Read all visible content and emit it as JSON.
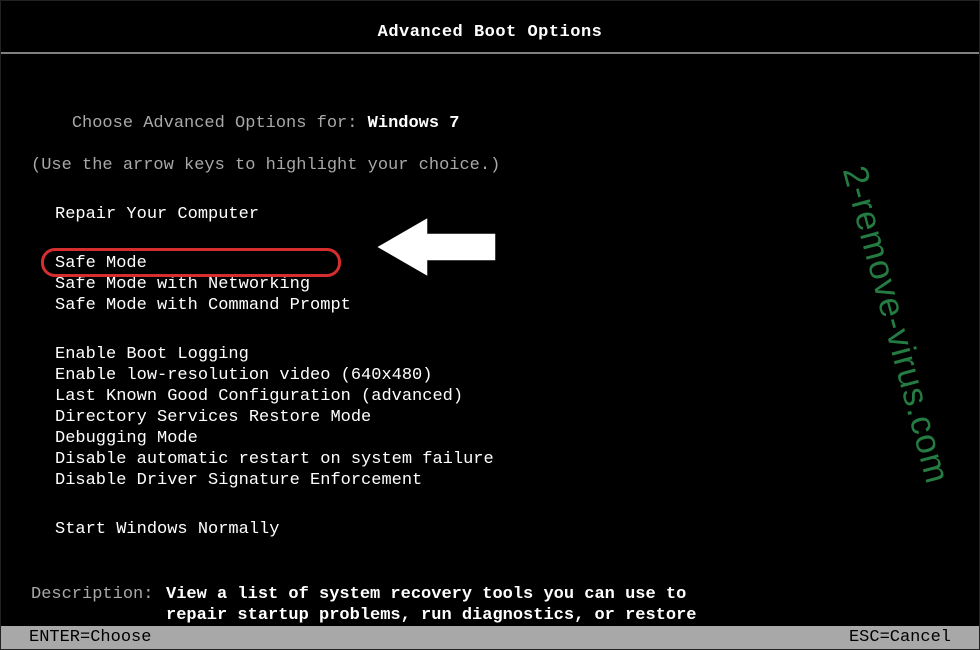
{
  "title": "Advanced Boot Options",
  "prompt": {
    "prefix": "Choose Advanced Options for: ",
    "os": "Windows 7",
    "hint": "(Use the arrow keys to highlight your choice.)"
  },
  "menu": {
    "group1": [
      "Repair Your Computer"
    ],
    "group2": [
      "Safe Mode",
      "Safe Mode with Networking",
      "Safe Mode with Command Prompt"
    ],
    "group3": [
      "Enable Boot Logging",
      "Enable low-resolution video (640x480)",
      "Last Known Good Configuration (advanced)",
      "Directory Services Restore Mode",
      "Debugging Mode",
      "Disable automatic restart on system failure",
      "Disable Driver Signature Enforcement"
    ],
    "group4": [
      "Start Windows Normally"
    ],
    "highlighted": "Safe Mode with Command Prompt"
  },
  "description": {
    "label": "Description:",
    "text": "View a list of system recovery tools you can use to repair startup problems, run diagnostics, or restore your system."
  },
  "footer": {
    "left": "ENTER=Choose",
    "right": "ESC=Cancel"
  },
  "watermark": "2-remove-virus.com",
  "annotation": {
    "arrow_color": "#ffffff",
    "ring_color": "#d62e2e"
  }
}
